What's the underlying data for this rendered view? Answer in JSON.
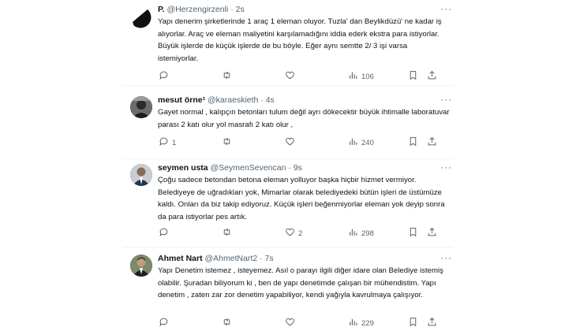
{
  "tweets": [
    {
      "name": "P.",
      "handle": "@Herzengirzenli",
      "dot": "·",
      "time": "2s",
      "body": "Yapı denerim şirketlerinde 1 araç 1 eleman oluyor. Tuzla' dan Beylikdüzü' ne kadar iş alıyorlar. Araç ve eleman maliyetini karşılamadığını iddia ederk ekstra para istiyorlar. Büyük işlerde de küçük işlerde de bu böyle. Eğer aynı semtte 2/ 3 işi varsa istemiyorlar.",
      "replies": "",
      "retweets": "",
      "likes": "",
      "views": "106"
    },
    {
      "name": "mesut örne¹",
      "handle": "@karaeskieth",
      "dot": "·",
      "time": "4s",
      "body": "Gayet normal , kalıpçın betonları tulum değil ayrı dökecektir büyük ihtimalle laboratuvar parası 2 katı olur yol masrafı 2 katı olur ,",
      "replies": "1",
      "retweets": "",
      "likes": "",
      "views": "240"
    },
    {
      "name": "seymen usta",
      "handle": "@SeymenSevencan",
      "dot": "·",
      "time": "9s",
      "body": "Çoğu sadece betondan betona eleman yolluyor başka hiçbir hizmet vermiyor. Belediyeye de uğradıkları yok, Mimarlar olarak belediyedeki bütün işleri de üstümüze kaldı. Onları da biz takip ediyoruz. Küçük işleri beğenmiyorlar eleman yok deyip sonra da para istiyorlar pes artık.",
      "replies": "",
      "retweets": "",
      "likes": "2",
      "views": "298"
    },
    {
      "name": "Ahmet Nart",
      "handle": "@AhmetNart2",
      "dot": "·",
      "time": "7s",
      "body": "Yapı Denetim istemez , isteyemez. Asıl o parayı ilgili diğer idare olan Belediye istemiş olabilir. Şuradan biliyorum ki , ben de yapı denetimde çalışan bir mühendistim. Yapı denetim , zaten zar zor denetim yapabiliyor, kendi yağıyla kavrulmaya çalışıyor.",
      "replies": "",
      "retweets": "",
      "likes": "",
      "views": "229"
    }
  ],
  "colors": {
    "text": "#0f1419",
    "muted": "#536471",
    "border": "#eff3f4"
  },
  "icons": [
    "more-icon",
    "reply-icon",
    "retweet-icon",
    "like-icon",
    "views-icon",
    "bookmark-icon",
    "share-icon"
  ]
}
